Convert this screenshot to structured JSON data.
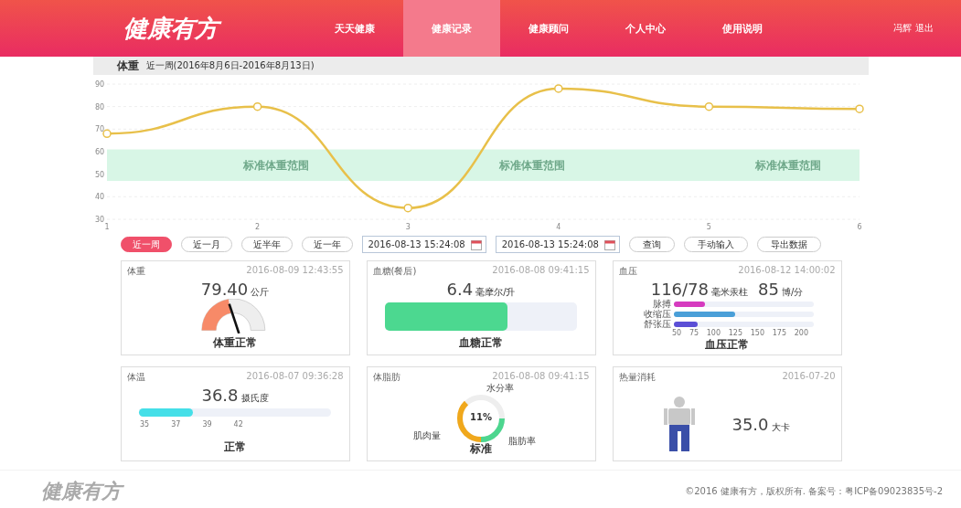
{
  "header": {
    "logo": "健康有方",
    "nav": [
      {
        "label": "天天健康",
        "selected": false
      },
      {
        "label": "健康记录",
        "selected": true
      },
      {
        "label": "健康顾问",
        "selected": false
      },
      {
        "label": "个人中心",
        "selected": false
      },
      {
        "label": "使用说明",
        "selected": false
      }
    ],
    "user": "冯辉",
    "logout": "退出"
  },
  "section": {
    "subtitle": "近一周(2016年8月6日-2016年8月13日)"
  },
  "chart_data": {
    "type": "line",
    "x": [
      1,
      2,
      3,
      4,
      5,
      6
    ],
    "series": [
      {
        "name": "体重",
        "color": "#e8c04a",
        "marker": "circle",
        "values": [
          68,
          80,
          35,
          88,
          80,
          79
        ]
      }
    ],
    "grid": true,
    "xlim": [
      1,
      6
    ],
    "ylim": [
      30,
      90
    ],
    "xticks": [
      1,
      2,
      3,
      4,
      5,
      6
    ],
    "yticks": [
      30,
      40,
      50,
      60,
      70,
      80,
      90
    ],
    "bands": [
      {
        "axis": "y",
        "from": 47,
        "to": 61,
        "color": "#d8f6e6"
      }
    ],
    "annotations": [
      "标准体重范围",
      "标准体重范围",
      "标准体重范围"
    ]
  },
  "periods": [
    {
      "label": "近一周",
      "selected": true
    },
    {
      "label": "近一月",
      "selected": false
    },
    {
      "label": "近半年",
      "selected": false
    },
    {
      "label": "近一年",
      "selected": false
    }
  ],
  "date_from": "2016-08-13 15:24:08",
  "date_to": "2016-08-13 15:24:08",
  "actions": [
    "查询",
    "手动输入",
    "导出数据"
  ],
  "cards": [
    {
      "kind": "gauge",
      "title": "体重",
      "time": "2016-08-09 12:43:55",
      "value": "79.40",
      "unit": "公斤",
      "status": "体重正常"
    },
    {
      "kind": "bar",
      "title": "血糖(餐后)",
      "time": "2016-08-08 09:41:15",
      "value": "6.4",
      "unit": "毫摩尔/升",
      "level": 0.64,
      "status": "血糖正常"
    },
    {
      "kind": "bp",
      "title": "血压",
      "time": "2016-08-12 14:00:02",
      "value": "116/78",
      "unit": "毫米汞柱",
      "value2": "85",
      "unit2": "博/分",
      "bars": [
        {
          "label": "脉搏",
          "color": "#d63bbf",
          "level": 0.22
        },
        {
          "label": "收缩压",
          "color": "#4a9fd8",
          "level": 0.44
        },
        {
          "label": "舒张压",
          "color": "#5b4fd6",
          "level": 0.17
        }
      ],
      "ticks": [
        "50",
        "75",
        "100",
        "125",
        "150",
        "175",
        "200"
      ],
      "status": "血压正常"
    },
    {
      "kind": "temp",
      "title": "体温",
      "time": "2016-08-07 09:36:28",
      "value": "36.8",
      "unit": "摄氏度",
      "level": 0.28,
      "ticks": [
        "35",
        "37",
        "39",
        "42"
      ],
      "status": "正常"
    },
    {
      "kind": "donut",
      "title": "体脂肪",
      "time": "2016-08-08 09:41:15",
      "center": "11%",
      "labels": [
        "水分率",
        "肌肉量",
        "脂肪率"
      ],
      "status": "标准"
    },
    {
      "kind": "figure",
      "title": "热量消耗",
      "time": "2016-07-20",
      "value": "35.0",
      "unit": "大卡"
    }
  ],
  "footer": {
    "logo": "健康有方",
    "copyright": "©2016 健康有方，版权所有.  备案号：粤ICP备09023835号-2"
  }
}
